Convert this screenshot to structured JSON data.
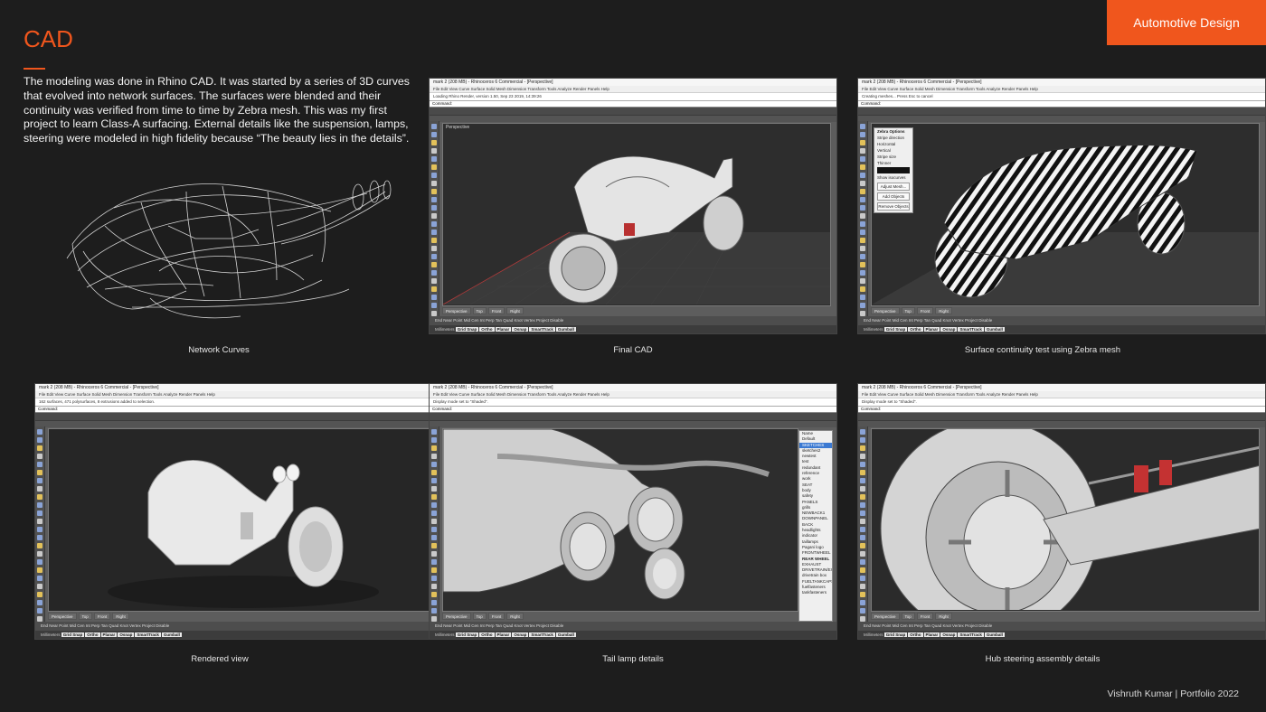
{
  "header": {
    "tag": "Automotive Design",
    "title": "CAD"
  },
  "intro": "The modeling was done in Rhino CAD. It was started by a series of 3D curves that evolved into network surfaces. The surfaces were blended and their continuity was verified from time to time by Zebra mesh. This was my first project to learn Class-A surfacing. External details like the suspension, lamps, steering were modeled in high fidelity because “The beauty lies in the details”.",
  "captions": {
    "network": "Network Curves",
    "final": "Final CAD",
    "zebra": "Surface continuity test using Zebra mesh",
    "rendered": "Rendered view",
    "taillamp": "Tail lamp details",
    "hub": "Hub steering assembly details"
  },
  "footer": "Vishruth Kumar | Portfolio 2022",
  "rhino": {
    "title": "mark 2 (208 MB) - Rhinoceros 6 Commercial - [Perspective]",
    "menu": "File  Edit  View  Curve  Surface  Solid  Mesh  Dimension  Transform  Tools  Analyze  Render  Panels  Help",
    "command": "Command:",
    "viewport_label": "Perspective",
    "tabs": [
      "Perspective",
      "Top",
      "Front",
      "Right"
    ],
    "osnaps": "End   Near   Point   Mid   Cen   Int   Perp   Tan   Quad   Knot   Vertex   Project   Disable",
    "status_buttons": [
      "Grid Snap",
      "Ortho",
      "Planar",
      "Osnap",
      "SmartTrack",
      "Gumball",
      "Record History"
    ],
    "units": "Millimeters",
    "layer": "Default"
  },
  "windows": {
    "final": {
      "history": "Loading Rhino Render, version 1.50, Sep 23 2019, 14:39:26"
    },
    "zebra": {
      "history": "Creating meshes... Press Esc to cancel",
      "dialog_title": "Zebra Options",
      "dialog_items": [
        "Stripe direction",
        "Horizontal",
        "Vertical",
        "Stripe size",
        "Thinner",
        "Show isocurves",
        "Adjust Mesh...",
        "Add Objects",
        "Remove Objects"
      ]
    },
    "rendered": {
      "history": "162 surfaces, 471 polysurfaces, 8 extrusions added to selection."
    },
    "taillamp": {
      "history": "Display mode set to \"Shaded\".",
      "layers": [
        "Name",
        "Default",
        "SKETCHES",
        "sketches2",
        "newtest",
        "test",
        "redundant",
        "reference",
        "work",
        "SEAT",
        "body",
        "safety",
        "PANELS",
        "grills",
        "NEWBACK1",
        "DOWNPANEL",
        "BACK",
        "headlights",
        "indicator",
        "taillamps",
        "Pagani logo",
        "FRONTWHEEL",
        "REAR WHEEL",
        "EXHAUST",
        "DRIVETRAIN/EXHAUST",
        "drivetrain box",
        "FUELTANKCAPS",
        "fuelfasteners",
        "tankfasteners"
      ]
    },
    "hub": {
      "history": "Display mode set to \"Shaded\"."
    }
  }
}
